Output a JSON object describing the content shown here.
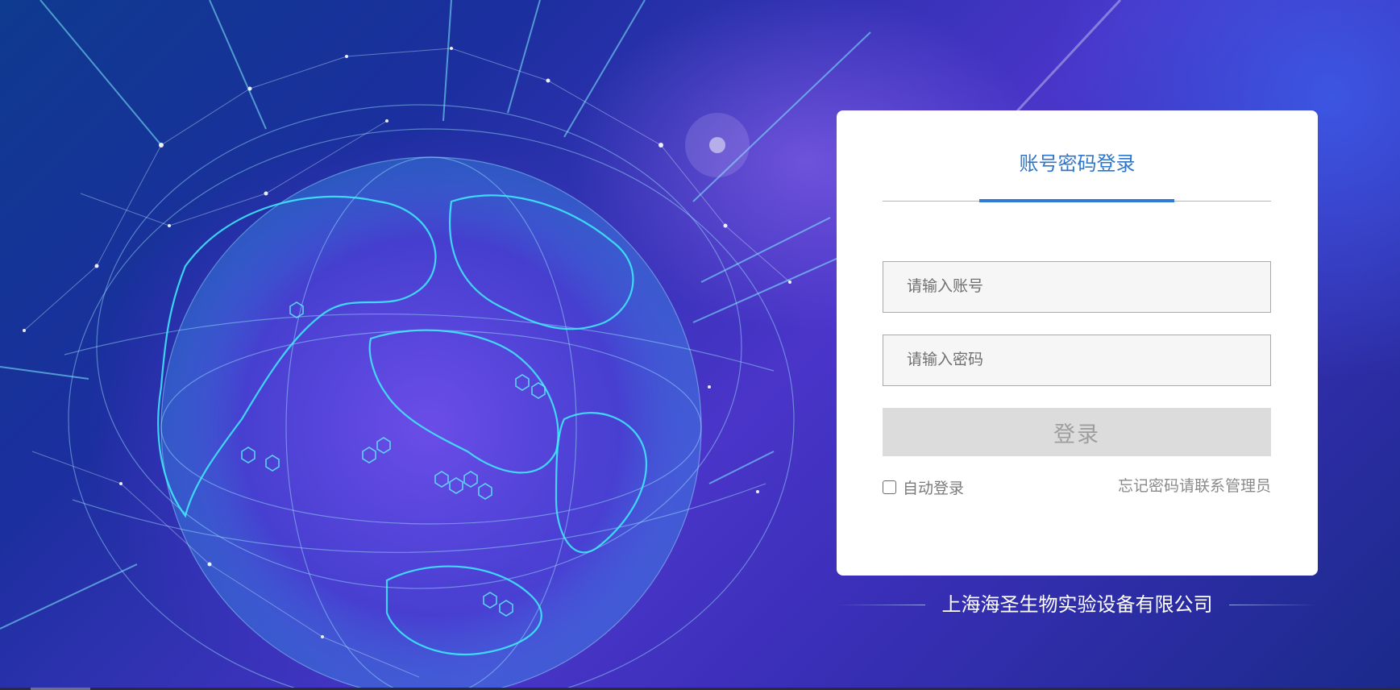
{
  "login": {
    "title": "账号密码登录",
    "account_placeholder": "请输入账号",
    "password_placeholder": "请输入密码",
    "submit_label": "登录",
    "remember_label": "自动登录",
    "remember_checked": false,
    "forgot_text": "忘记密码请联系管理员"
  },
  "footer": {
    "company_name": "上海海圣生物实验设备有限公司"
  },
  "background": {
    "image": "globe-network-illustration"
  },
  "colors": {
    "accent": "#2f76c9",
    "card": "#ffffff",
    "button_disabled": "#dcdcdc"
  }
}
